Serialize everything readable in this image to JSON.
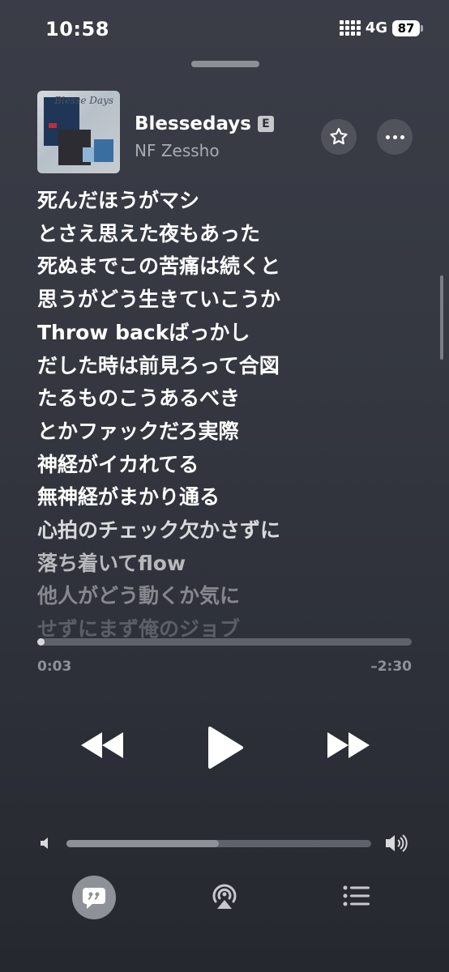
{
  "status_bar": {
    "time": "10:58",
    "network": "4G",
    "battery": "87"
  },
  "now_playing": {
    "title": "Blessedays",
    "explicit_badge": "E",
    "artist": "NF Zessho",
    "artwork_text": "Blesse Days",
    "favorite_icon": "star-icon",
    "more_icon": "ellipsis-icon"
  },
  "lyrics": [
    "死んだほうがマシ",
    "とさえ思えた夜もあった",
    "死ぬまでこの苦痛は続くと",
    "思うがどう生きていこうか",
    "Throw backばっかし",
    "だした時は前見ろって合図",
    "たるものこうあるべき",
    "とかファックだろ実際",
    "神経がイカれてる",
    "無神経がまかり通る",
    "心拍のチェック欠かさずに",
    "落ち着いてflow",
    "他人がどう動くか気に",
    "せずにまず俺のジョブ"
  ],
  "playback": {
    "elapsed": "0:03",
    "remaining": "–2:30",
    "progress_fraction": 0.02,
    "volume_fraction": 0.5
  },
  "controls": {
    "previous_icon": "backward-icon",
    "play_icon": "play-icon",
    "next_icon": "forward-icon"
  },
  "bottom_bar": {
    "lyrics_icon": "lyrics-quote-icon",
    "airplay_icon": "airplay-audio-icon",
    "queue_icon": "queue-list-icon"
  },
  "colors": {
    "background": "#353841",
    "text_primary": "#ffffff",
    "text_secondary": "#a9abb2"
  }
}
